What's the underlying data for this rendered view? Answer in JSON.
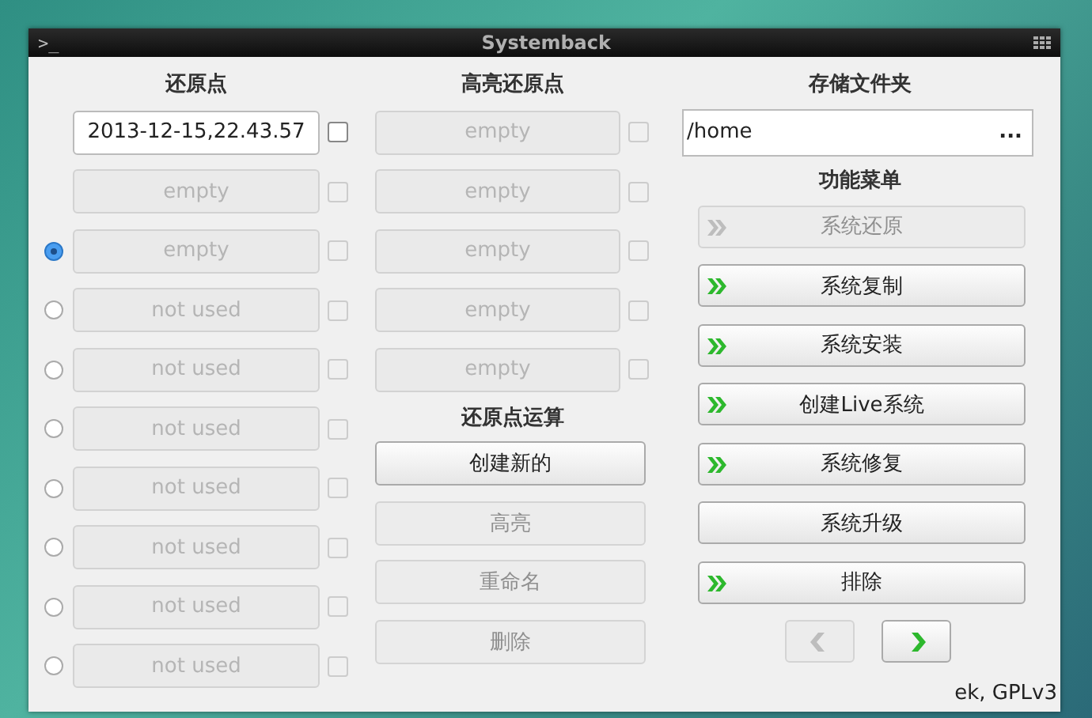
{
  "window": {
    "title": "Systemback",
    "prompt": ">_"
  },
  "restore_points": {
    "header": "还原点",
    "rows": [
      {
        "text": "2013-12-15,22.43.57",
        "disabled": false,
        "checked": false
      },
      {
        "text": "empty",
        "disabled": true,
        "checked": false
      },
      {
        "text": "empty",
        "disabled": true,
        "checked": false,
        "selected": true
      },
      {
        "text": "not used",
        "disabled": true,
        "checked": false,
        "selected": false
      },
      {
        "text": "not used",
        "disabled": true,
        "checked": false,
        "selected": false
      },
      {
        "text": "not used",
        "disabled": true,
        "checked": false,
        "selected": false
      },
      {
        "text": "not used",
        "disabled": true,
        "checked": false,
        "selected": false
      },
      {
        "text": "not used",
        "disabled": true,
        "checked": false,
        "selected": false
      },
      {
        "text": "not used",
        "disabled": true,
        "checked": false,
        "selected": false
      },
      {
        "text": "not used",
        "disabled": true,
        "checked": false,
        "selected": false
      }
    ]
  },
  "highlighted_points": {
    "header": "高亮还原点",
    "rows": [
      {
        "text": "empty",
        "disabled": true,
        "checked": false
      },
      {
        "text": "empty",
        "disabled": true,
        "checked": false
      },
      {
        "text": "empty",
        "disabled": true,
        "checked": false
      },
      {
        "text": "empty",
        "disabled": true,
        "checked": false
      },
      {
        "text": "empty",
        "disabled": true,
        "checked": false
      }
    ]
  },
  "point_operations": {
    "header": "还原点运算",
    "buttons": [
      {
        "label": "创建新的",
        "disabled": false
      },
      {
        "label": "高亮",
        "disabled": true
      },
      {
        "label": "重命名",
        "disabled": true
      },
      {
        "label": "删除",
        "disabled": true
      }
    ]
  },
  "storage_folder": {
    "header": "存储文件夹",
    "path": "/home",
    "browse": "..."
  },
  "function_menu": {
    "header": "功能菜单",
    "buttons": [
      {
        "label": "系统还原",
        "disabled": true,
        "arrow": true
      },
      {
        "label": "系统复制",
        "disabled": false,
        "arrow": true
      },
      {
        "label": "系统安装",
        "disabled": false,
        "arrow": true
      },
      {
        "label": "创建Live系统",
        "disabled": false,
        "arrow": true
      },
      {
        "label": "系统修复",
        "disabled": false,
        "arrow": true
      },
      {
        "label": "系统升级",
        "disabled": false,
        "arrow": false
      },
      {
        "label": "排除",
        "disabled": false,
        "arrow": true
      }
    ]
  },
  "navigation": [
    {
      "kind": "back",
      "disabled": true
    },
    {
      "kind": "forward",
      "disabled": false
    }
  ],
  "footer": "ek, GPLv3"
}
